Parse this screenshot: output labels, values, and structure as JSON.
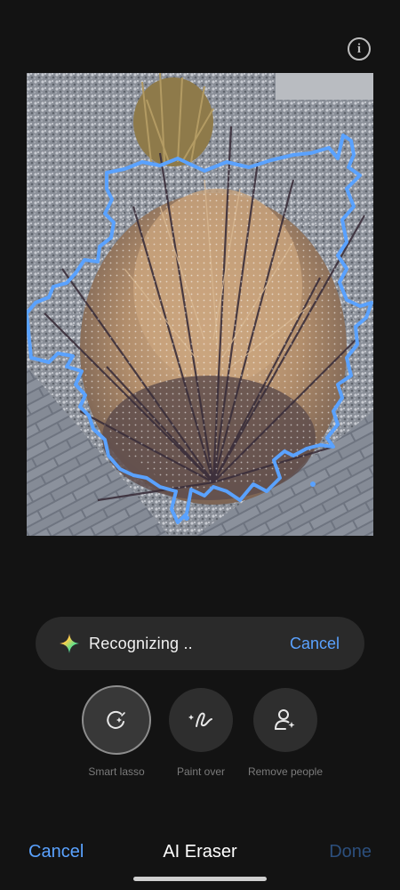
{
  "header": {
    "info_icon": "info-icon",
    "info_glyph": "i"
  },
  "status": {
    "text": "Recognizing ..",
    "cancel_label": "Cancel",
    "icon": "sparkle-icon"
  },
  "tools": [
    {
      "label": "Smart lasso",
      "icon": "smart-lasso-icon",
      "active": true
    },
    {
      "label": "Paint over",
      "icon": "paint-over-icon",
      "active": false
    },
    {
      "label": "Remove people",
      "icon": "remove-people-icon",
      "active": false
    }
  ],
  "bottom_bar": {
    "cancel_label": "Cancel",
    "title": "AI Eraser",
    "done_label": "Done"
  },
  "colors": {
    "accent": "#5aa2ff",
    "selection_outline": "#5aa2ff",
    "done_disabled": "#2c4f7d",
    "background": "#131313"
  }
}
